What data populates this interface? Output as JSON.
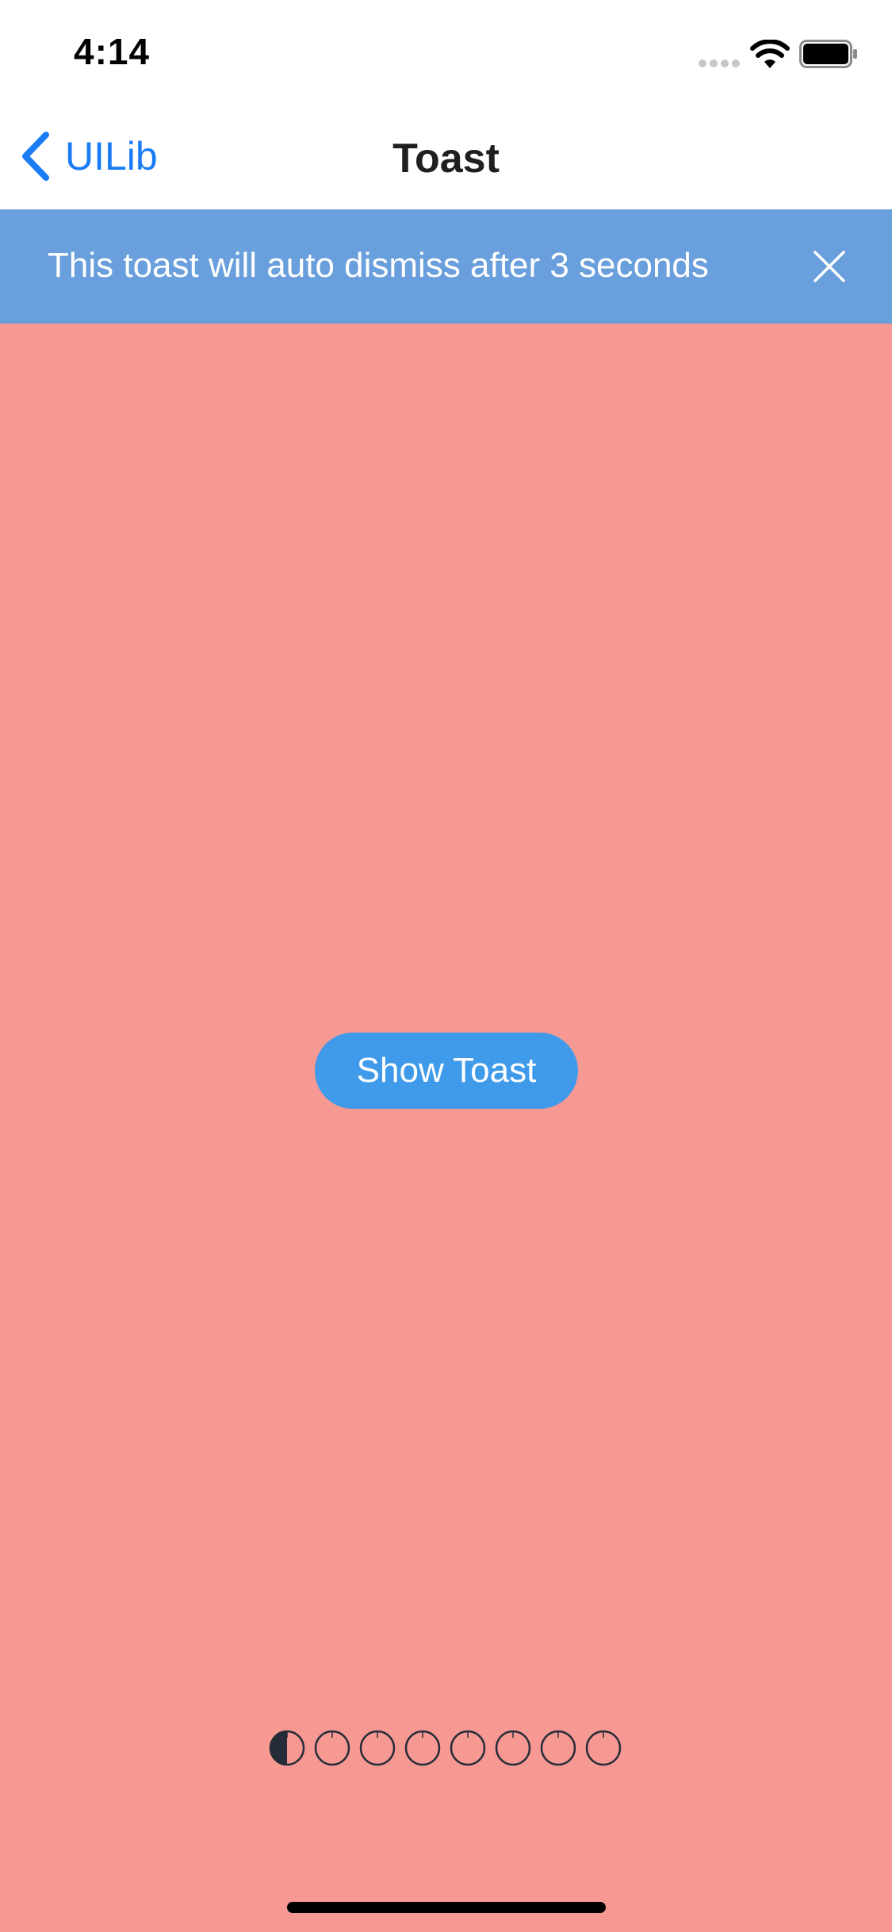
{
  "status_bar": {
    "time": "4:14",
    "signal_icon": "cellular-signal-icon",
    "wifi_icon": "wifi-icon",
    "battery_icon": "battery-icon"
  },
  "nav_bar": {
    "back_label": "UILib",
    "back_icon": "chevron-left-icon",
    "title": "Toast"
  },
  "toast": {
    "message": "This toast will auto dismiss after 3 seconds",
    "close_icon": "close-icon"
  },
  "main": {
    "show_toast_label": "Show Toast"
  },
  "page_indicator": {
    "total_pages": 8,
    "current_page": 1
  },
  "colors": {
    "background": "#F69993",
    "toast_background": "#699FDC",
    "button_background": "#3F9BEA",
    "accent": "#1A7CF5",
    "indicator": "#262B38"
  }
}
